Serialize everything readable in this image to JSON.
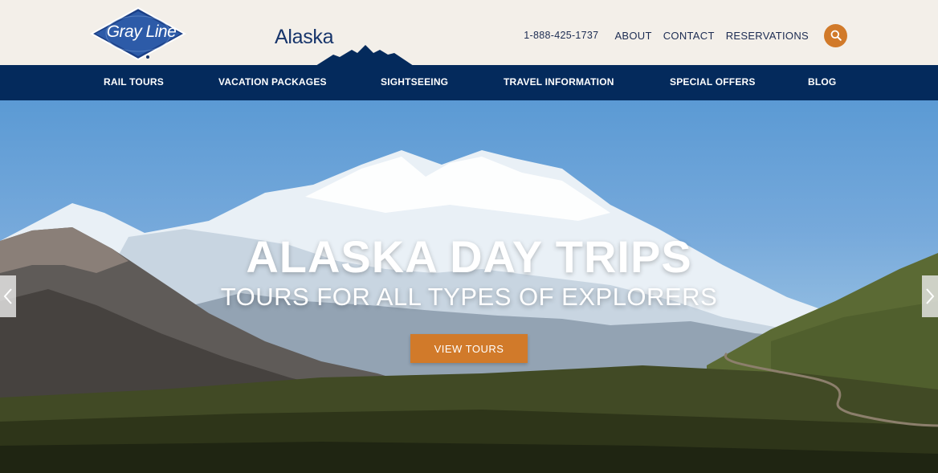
{
  "brand": {
    "badge_text": "Gray Line",
    "name": "Alaska",
    "colors": {
      "navy": "#042a5c",
      "orange": "#d17a2a",
      "cream": "#f3efe9"
    }
  },
  "utility": {
    "phone": "1-888-425-1737",
    "links": [
      "ABOUT",
      "CONTACT",
      "RESERVATIONS"
    ],
    "search_icon": "search-icon"
  },
  "nav": {
    "items": [
      "RAIL TOURS",
      "VACATION PACKAGES",
      "SIGHTSEEING",
      "TRAVEL INFORMATION",
      "SPECIAL OFFERS",
      "BLOG"
    ]
  },
  "hero": {
    "headline": "ALASKA DAY TRIPS",
    "subline": "TOURS FOR ALL TYPES OF EXPLORERS",
    "cta_label": "VIEW TOURS",
    "prev_icon": "chevron-left-icon",
    "next_icon": "chevron-right-icon"
  }
}
